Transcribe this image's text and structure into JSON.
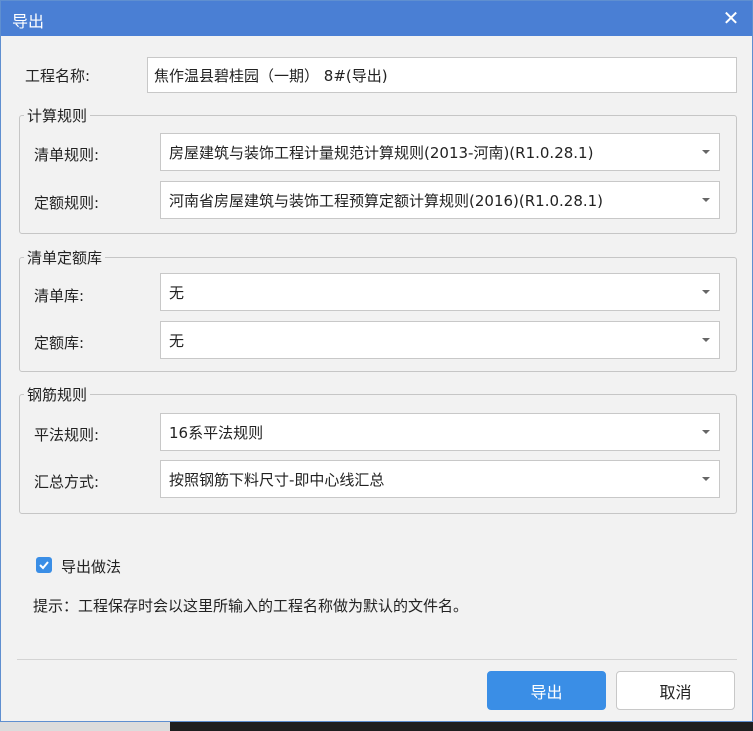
{
  "window": {
    "title": "导出",
    "close_glyph": "✕"
  },
  "project": {
    "label": "工程名称:",
    "value": "焦作温县碧桂园（一期） 8#(导出)"
  },
  "calc_rules": {
    "title": "计算规则",
    "list_rule": {
      "label": "清单规则:",
      "value": "房屋建筑与装饰工程计量规范计算规则(2013-河南)(R1.0.28.1)"
    },
    "quota_rule": {
      "label": "定额规则:",
      "value": "河南省房屋建筑与装饰工程预算定额计算规则(2016)(R1.0.28.1)"
    }
  },
  "library": {
    "title": "清单定额库",
    "list_lib": {
      "label": "清单库:",
      "value": "无"
    },
    "quota_lib": {
      "label": "定额库:",
      "value": "无"
    }
  },
  "rebar": {
    "title": "钢筋规则",
    "flat_rule": {
      "label": "平法规则:",
      "value": "16系平法规则"
    },
    "summary": {
      "label": "汇总方式:",
      "value": "按照钢筋下料尺寸-即中心线汇总"
    }
  },
  "export_method": {
    "label": "导出做法",
    "checked": true
  },
  "hint": "提示：工程保存时会以这里所输入的工程名称做为默认的文件名。",
  "buttons": {
    "export": "导出",
    "cancel": "取消"
  },
  "colors": {
    "title_bar": "#4a7fd4",
    "primary": "#3a8ee6"
  }
}
